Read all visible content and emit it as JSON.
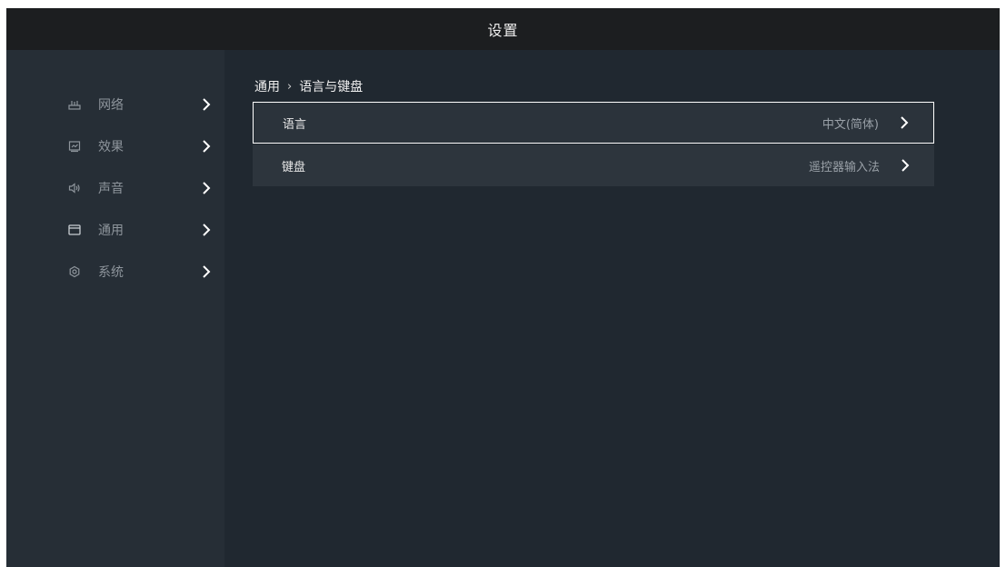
{
  "header": {
    "title": "设置"
  },
  "sidebar": {
    "items": [
      {
        "label": "网络",
        "icon": "network-icon"
      },
      {
        "label": "效果",
        "icon": "display-effect-icon"
      },
      {
        "label": "声音",
        "icon": "speaker-icon"
      },
      {
        "label": "通用",
        "icon": "window-icon"
      },
      {
        "label": "系统",
        "icon": "gear-icon"
      }
    ]
  },
  "breadcrumb": {
    "parent": "通用",
    "separator": "›",
    "current": "语言与键盘"
  },
  "rows": [
    {
      "label": "语言",
      "value": "中文(简体)",
      "selected": true
    },
    {
      "label": "键盘",
      "value": "遥控器输入法",
      "selected": false
    }
  ],
  "colors": {
    "background": "#202830",
    "topbar": "#1c1e20",
    "sidebar": "#262e36",
    "row": "#2d353d",
    "focus_border": "#ffffff"
  }
}
